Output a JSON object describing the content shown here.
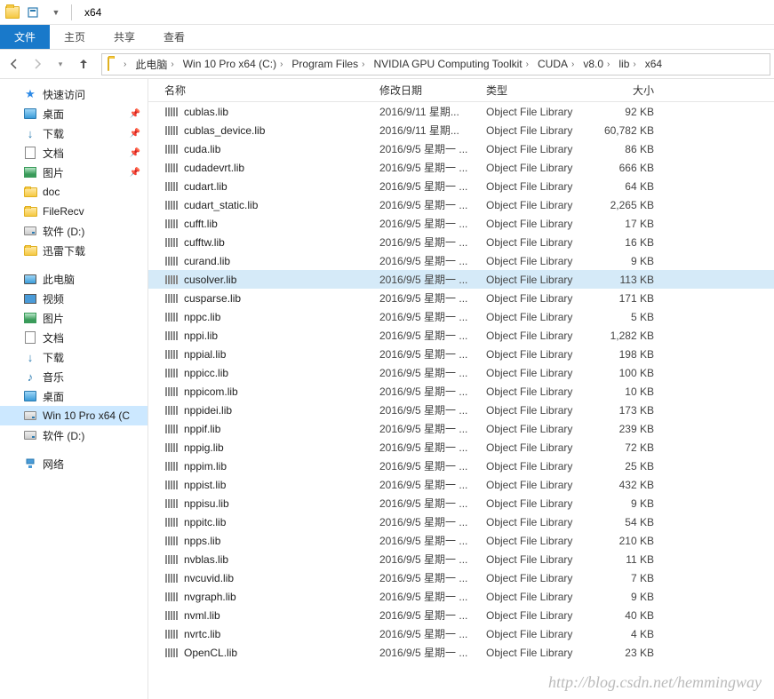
{
  "window": {
    "title": "x64"
  },
  "tabs": {
    "file": "文件",
    "home": "主页",
    "share": "共享",
    "view": "查看"
  },
  "breadcrumbs": [
    "此电脑",
    "Win 10 Pro x64 (C:)",
    "Program Files",
    "NVIDIA GPU Computing Toolkit",
    "CUDA",
    "v8.0",
    "lib",
    "x64"
  ],
  "columns": {
    "name": "名称",
    "date": "修改日期",
    "type": "类型",
    "size": "大小"
  },
  "nav": {
    "quick": {
      "label": "快速访问",
      "items": [
        {
          "label": "桌面",
          "icon": "desktop",
          "pin": true
        },
        {
          "label": "下载",
          "icon": "download",
          "pin": true
        },
        {
          "label": "文档",
          "icon": "doc",
          "pin": true
        },
        {
          "label": "图片",
          "icon": "pic",
          "pin": true
        },
        {
          "label": "doc",
          "icon": "folder",
          "pin": false
        },
        {
          "label": "FileRecv",
          "icon": "folder",
          "pin": false
        },
        {
          "label": "软件 (D:)",
          "icon": "drive",
          "pin": false
        },
        {
          "label": "迅雷下载",
          "icon": "folder",
          "pin": false
        }
      ]
    },
    "pc": {
      "label": "此电脑",
      "items": [
        {
          "label": "视频",
          "icon": "video"
        },
        {
          "label": "图片",
          "icon": "pic"
        },
        {
          "label": "文档",
          "icon": "doc"
        },
        {
          "label": "下载",
          "icon": "download"
        },
        {
          "label": "音乐",
          "icon": "music"
        },
        {
          "label": "桌面",
          "icon": "desktop"
        },
        {
          "label": "Win 10 Pro x64 (C",
          "icon": "drive",
          "selected": true
        },
        {
          "label": "软件 (D:)",
          "icon": "drive"
        }
      ]
    },
    "network": {
      "label": "网络"
    }
  },
  "files": [
    {
      "name": "cublas.lib",
      "date": "2016/9/11 星期...",
      "type": "Object File Library",
      "size": "92 KB"
    },
    {
      "name": "cublas_device.lib",
      "date": "2016/9/11 星期...",
      "type": "Object File Library",
      "size": "60,782 KB"
    },
    {
      "name": "cuda.lib",
      "date": "2016/9/5 星期一 ...",
      "type": "Object File Library",
      "size": "86 KB"
    },
    {
      "name": "cudadevrt.lib",
      "date": "2016/9/5 星期一 ...",
      "type": "Object File Library",
      "size": "666 KB"
    },
    {
      "name": "cudart.lib",
      "date": "2016/9/5 星期一 ...",
      "type": "Object File Library",
      "size": "64 KB"
    },
    {
      "name": "cudart_static.lib",
      "date": "2016/9/5 星期一 ...",
      "type": "Object File Library",
      "size": "2,265 KB"
    },
    {
      "name": "cufft.lib",
      "date": "2016/9/5 星期一 ...",
      "type": "Object File Library",
      "size": "17 KB"
    },
    {
      "name": "cufftw.lib",
      "date": "2016/9/5 星期一 ...",
      "type": "Object File Library",
      "size": "16 KB"
    },
    {
      "name": "curand.lib",
      "date": "2016/9/5 星期一 ...",
      "type": "Object File Library",
      "size": "9 KB"
    },
    {
      "name": "cusolver.lib",
      "date": "2016/9/5 星期一 ...",
      "type": "Object File Library",
      "size": "113 KB",
      "selected": true
    },
    {
      "name": "cusparse.lib",
      "date": "2016/9/5 星期一 ...",
      "type": "Object File Library",
      "size": "171 KB"
    },
    {
      "name": "nppc.lib",
      "date": "2016/9/5 星期一 ...",
      "type": "Object File Library",
      "size": "5 KB"
    },
    {
      "name": "nppi.lib",
      "date": "2016/9/5 星期一 ...",
      "type": "Object File Library",
      "size": "1,282 KB"
    },
    {
      "name": "nppial.lib",
      "date": "2016/9/5 星期一 ...",
      "type": "Object File Library",
      "size": "198 KB"
    },
    {
      "name": "nppicc.lib",
      "date": "2016/9/5 星期一 ...",
      "type": "Object File Library",
      "size": "100 KB"
    },
    {
      "name": "nppicom.lib",
      "date": "2016/9/5 星期一 ...",
      "type": "Object File Library",
      "size": "10 KB"
    },
    {
      "name": "nppidei.lib",
      "date": "2016/9/5 星期一 ...",
      "type": "Object File Library",
      "size": "173 KB"
    },
    {
      "name": "nppif.lib",
      "date": "2016/9/5 星期一 ...",
      "type": "Object File Library",
      "size": "239 KB"
    },
    {
      "name": "nppig.lib",
      "date": "2016/9/5 星期一 ...",
      "type": "Object File Library",
      "size": "72 KB"
    },
    {
      "name": "nppim.lib",
      "date": "2016/9/5 星期一 ...",
      "type": "Object File Library",
      "size": "25 KB"
    },
    {
      "name": "nppist.lib",
      "date": "2016/9/5 星期一 ...",
      "type": "Object File Library",
      "size": "432 KB"
    },
    {
      "name": "nppisu.lib",
      "date": "2016/9/5 星期一 ...",
      "type": "Object File Library",
      "size": "9 KB"
    },
    {
      "name": "nppitc.lib",
      "date": "2016/9/5 星期一 ...",
      "type": "Object File Library",
      "size": "54 KB"
    },
    {
      "name": "npps.lib",
      "date": "2016/9/5 星期一 ...",
      "type": "Object File Library",
      "size": "210 KB"
    },
    {
      "name": "nvblas.lib",
      "date": "2016/9/5 星期一 ...",
      "type": "Object File Library",
      "size": "11 KB"
    },
    {
      "name": "nvcuvid.lib",
      "date": "2016/9/5 星期一 ...",
      "type": "Object File Library",
      "size": "7 KB"
    },
    {
      "name": "nvgraph.lib",
      "date": "2016/9/5 星期一 ...",
      "type": "Object File Library",
      "size": "9 KB"
    },
    {
      "name": "nvml.lib",
      "date": "2016/9/5 星期一 ...",
      "type": "Object File Library",
      "size": "40 KB"
    },
    {
      "name": "nvrtc.lib",
      "date": "2016/9/5 星期一 ...",
      "type": "Object File Library",
      "size": "4 KB"
    },
    {
      "name": "OpenCL.lib",
      "date": "2016/9/5 星期一 ...",
      "type": "Object File Library",
      "size": "23 KB"
    }
  ],
  "watermark": "http://blog.csdn.net/hemmingway"
}
